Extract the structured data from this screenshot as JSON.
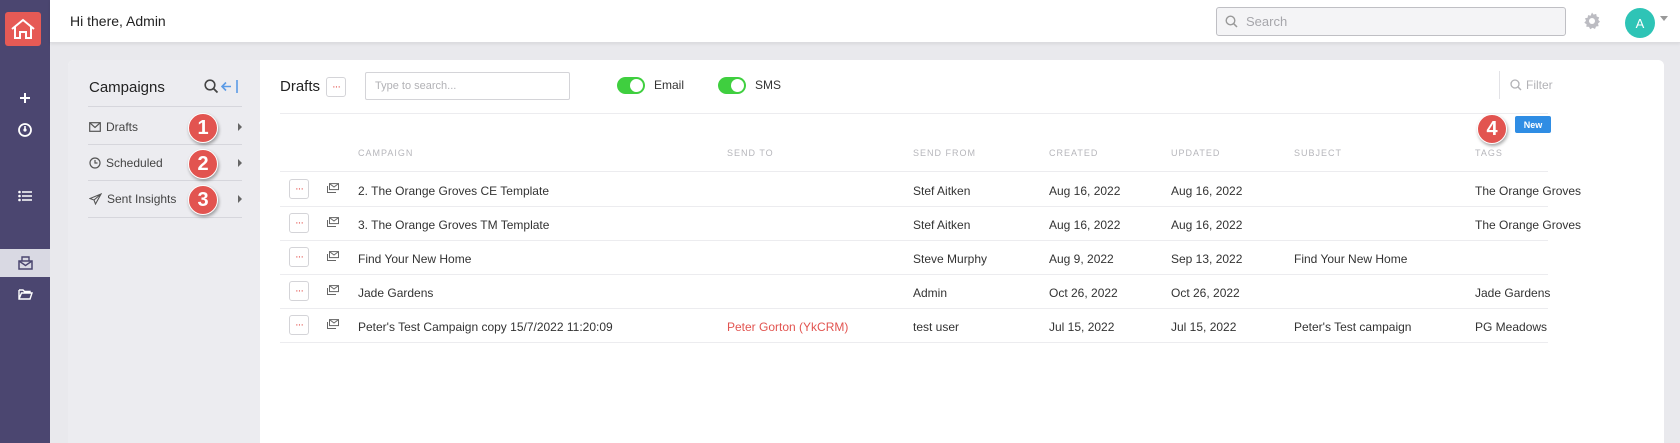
{
  "topbar": {
    "greeting": "Hi there, Admin",
    "search_placeholder": "Search",
    "avatar_initial": "A"
  },
  "sidebar": {
    "title": "Campaigns",
    "items": [
      {
        "label": "Drafts",
        "badge": "1",
        "icon": "mail-icon"
      },
      {
        "label": "Scheduled",
        "badge": "2",
        "icon": "clock-icon"
      },
      {
        "label": "Sent Insights",
        "badge": "3",
        "icon": "paper-plane-icon"
      }
    ]
  },
  "main": {
    "title": "Drafts",
    "search_placeholder": "Type to search...",
    "toggles": [
      {
        "label": "Email",
        "on": true
      },
      {
        "label": "SMS",
        "on": true
      }
    ],
    "filter_label": "Filter",
    "new_badge": "4",
    "new_button": "New",
    "columns": [
      "CAMPAIGN",
      "SEND TO",
      "SEND FROM",
      "CREATED",
      "UPDATED",
      "SUBJECT",
      "TAGS"
    ],
    "rows": [
      {
        "campaign": "2. The Orange Groves CE Template",
        "send_to": "",
        "send_from": "Stef Aitken",
        "created": "Aug 16, 2022",
        "updated": "Aug 16, 2022",
        "subject": "",
        "tags": "The Orange Groves"
      },
      {
        "campaign": "3. The Orange Groves TM Template",
        "send_to": "",
        "send_from": "Stef Aitken",
        "created": "Aug 16, 2022",
        "updated": "Aug 16, 2022",
        "subject": "",
        "tags": "The Orange Groves"
      },
      {
        "campaign": "Find Your New Home",
        "send_to": "",
        "send_from": "Steve Murphy",
        "created": "Aug 9, 2022",
        "updated": "Sep 13, 2022",
        "subject": "Find Your New Home",
        "tags": ""
      },
      {
        "campaign": "Jade Gardens",
        "send_to": "",
        "send_from": "Admin",
        "created": "Oct 26, 2022",
        "updated": "Oct 26, 2022",
        "subject": "",
        "tags": "Jade Gardens"
      },
      {
        "campaign": "Peter's Test Campaign copy 15/7/2022 11:20:09",
        "send_to": "Peter Gorton (YkCRM)",
        "send_from": "test user",
        "created": "Jul 15, 2022",
        "updated": "Jul 15, 2022",
        "subject": "Peter's Test campaign",
        "tags": "PG Meadows"
      }
    ]
  },
  "colors": {
    "rail": "#4b4670",
    "accent_red": "#e25450",
    "toggle_green": "#3fcf3f",
    "button_blue": "#2f8de4",
    "avatar_teal": "#2ec4b6"
  }
}
